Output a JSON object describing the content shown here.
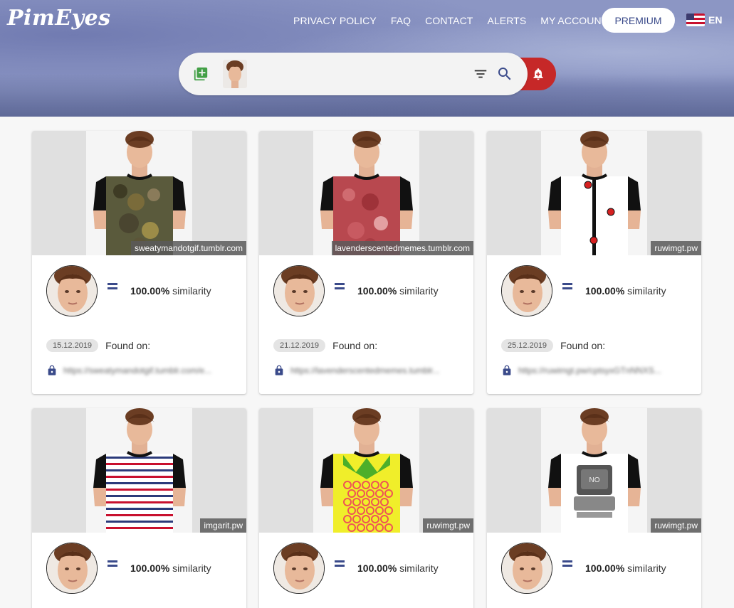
{
  "brand": {
    "logo_text": "PimEyes",
    "accent": "#3a4a8a",
    "alert_color": "#c62828"
  },
  "nav": {
    "links": [
      "PRIVACY POLICY",
      "FAQ",
      "CONTACT",
      "ALERTS",
      "MY ACCOUNT"
    ],
    "premium_label": "PREMIUM",
    "language": "EN"
  },
  "search": {
    "icons": [
      "add-photo-icon",
      "filter-icon",
      "search-icon",
      "alert-bell-icon"
    ]
  },
  "results": [
    {
      "domain": "sweatymandotgif.tumblr.com",
      "similarity": "100.00%",
      "similarity_label": "similarity",
      "date": "15.12.2019",
      "found_on": "Found on:",
      "url": "https://sweatymandotgif.tumblr.com/e...",
      "shirt": "camo"
    },
    {
      "domain": "lavenderscentedmemes.tumblr.com",
      "similarity": "100.00%",
      "similarity_label": "similarity",
      "date": "21.12.2019",
      "found_on": "Found on:",
      "url": "https://lavenderscentedmemes.tumblr...",
      "shirt": "meat"
    },
    {
      "domain": "ruwimgt.pw",
      "similarity": "100.00%",
      "similarity_label": "similarity",
      "date": "25.12.2019",
      "found_on": "Found on:",
      "url": "https://ruwimgt.pw/cptsyxGTnNNXS...",
      "shirt": "buttons"
    },
    {
      "domain": "imgarit.pw",
      "similarity": "100.00%",
      "similarity_label": "similarity",
      "shirt": "stripes"
    },
    {
      "domain": "ruwimgt.pw",
      "similarity": "100.00%",
      "similarity_label": "similarity",
      "shirt": "pineapple"
    },
    {
      "domain": "ruwimgt.pw",
      "similarity": "100.00%",
      "similarity_label": "similarity",
      "shirt": "computer",
      "shirt_text": "NO"
    }
  ]
}
